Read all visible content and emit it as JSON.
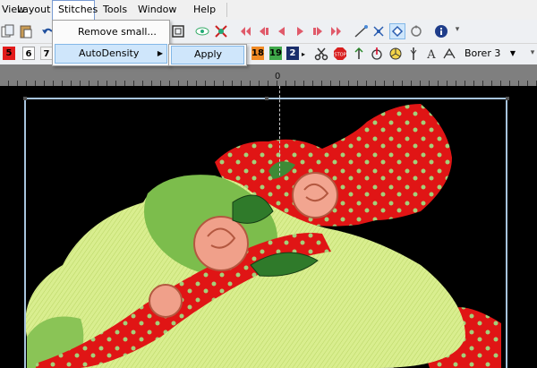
{
  "menubar": {
    "items": [
      "View",
      "Layout",
      "Stitches",
      "Tools",
      "Window",
      "Help"
    ],
    "active": "Stitches"
  },
  "stitches_menu": {
    "items": [
      {
        "label": "Remove small...",
        "underline": "R"
      },
      {
        "label": "AutoDensity",
        "underline": "A",
        "has_submenu": true
      }
    ]
  },
  "autodensity_submenu": {
    "items": [
      {
        "label": "Apply",
        "underline": "A"
      }
    ]
  },
  "toolbar": {
    "color_slots": [
      "5",
      "6",
      "7"
    ],
    "color_slots_right": [
      "18",
      "19",
      "2"
    ],
    "thread_combo": "Borer 3"
  },
  "ruler": {
    "zero_label": "0"
  },
  "colors": {
    "menubar_bg": "#f0f0f0",
    "highlight": "#cfe6fb",
    "highlight_border": "#83b8e8",
    "canvas": "#000000",
    "hoop_frame": "#a7c4dd"
  }
}
